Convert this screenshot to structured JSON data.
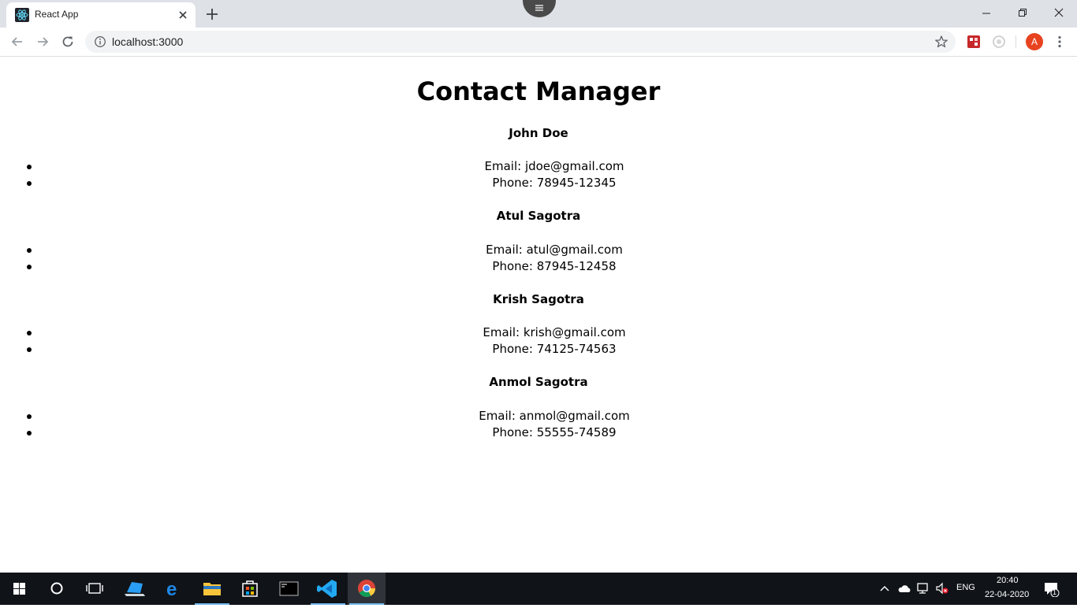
{
  "browser": {
    "tab_title": "React App",
    "url": "localhost:3000",
    "profile_initial": "A"
  },
  "page": {
    "title": "Contact Manager",
    "contacts": [
      {
        "name": "John Doe",
        "email": "Email: jdoe@gmail.com",
        "phone": "Phone: 78945-12345"
      },
      {
        "name": "Atul Sagotra",
        "email": "Email: atul@gmail.com",
        "phone": "Phone: 87945-12458"
      },
      {
        "name": "Krish Sagotra",
        "email": "Email: krish@gmail.com",
        "phone": "Phone: 74125-74563"
      },
      {
        "name": "Anmol Sagotra",
        "email": "Email: anmol@gmail.com",
        "phone": "Phone: 55555-74589"
      }
    ]
  },
  "taskbar": {
    "language": "ENG",
    "time": "20:40",
    "date": "22-04-2020",
    "notification_count": "1"
  },
  "colors": {
    "tabstrip": "#dee1e6",
    "omnibox": "#f1f3f4",
    "avatar": "#e8431f",
    "taskbar": "#101318",
    "react_blue": "#61dafb"
  }
}
